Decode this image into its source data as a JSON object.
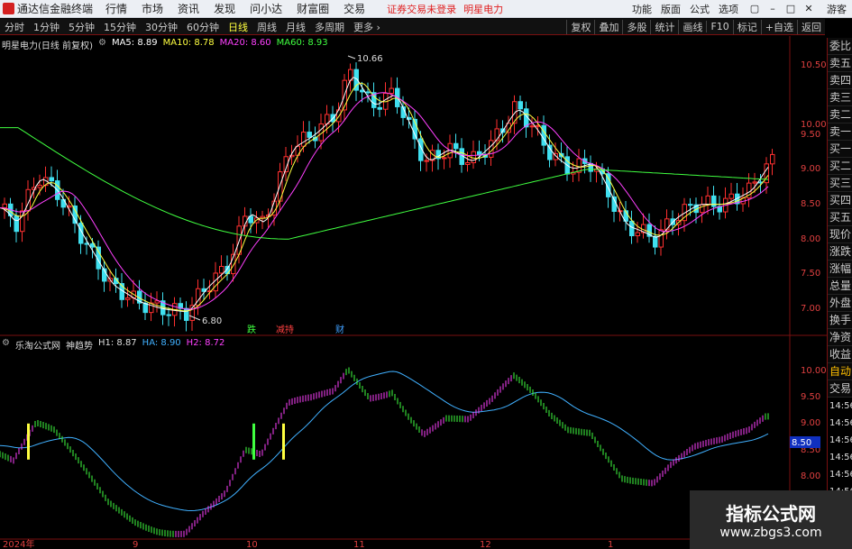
{
  "menubar": {
    "app_title": "通达信金融终端",
    "items": [
      "行情",
      "市场",
      "资讯",
      "发现",
      "问小达",
      "财富圈",
      "交易"
    ],
    "alert": "证券交易未登录",
    "stock": "明星电力",
    "tools": [
      "功能",
      "版面",
      "公式",
      "选项"
    ],
    "user": "游客"
  },
  "tabbar": {
    "tabs": [
      "分时",
      "1分钟",
      "5分钟",
      "15分钟",
      "30分钟",
      "60分钟",
      "日线",
      "周线",
      "月线",
      "多周期",
      "更多"
    ],
    "active": "日线",
    "right_buttons": [
      "复权",
      "叠加",
      "多股",
      "统计",
      "画线",
      "F10",
      "标记",
      "+自选",
      "返回"
    ]
  },
  "main_legend": {
    "title": "明星电力(日线 前复权)",
    "ma": [
      {
        "label": "MA5: 8.89",
        "color": "#ffffff"
      },
      {
        "label": "MA10: 8.78",
        "color": "#ffff40"
      },
      {
        "label": "MA20: 8.60",
        "color": "#ff40ff"
      },
      {
        "label": "MA60: 8.93",
        "color": "#40ff40"
      }
    ]
  },
  "main_axis": {
    "labels": [
      "10.50",
      "10.00",
      "9.50",
      "9.00",
      "8.50",
      "8.00",
      "7.50",
      "7.00"
    ]
  },
  "annotations": {
    "high": "10.66",
    "low": "6.80",
    "sig1": "跌",
    "sig2": "减持",
    "sig3": "财"
  },
  "sub_legend": {
    "name": "乐淘公式网",
    "indicator": "神趋势",
    "items": [
      {
        "label": "H1: 8.87",
        "color": "#dddddd"
      },
      {
        "label": "HA: 8.90",
        "color": "#40b0ff"
      },
      {
        "label": "H2: 8.72",
        "color": "#ff40ff"
      }
    ]
  },
  "sub_axis": {
    "labels": [
      "10.00",
      "9.50",
      "9.00",
      "8.50",
      "8.00"
    ],
    "current": "8.50"
  },
  "x_axis": {
    "labels": [
      "2024年",
      "9",
      "10",
      "11",
      "12",
      "1"
    ]
  },
  "side_panel": {
    "items": [
      "委比",
      "卖五",
      "卖四",
      "卖三",
      "卖二",
      "卖一",
      "买一",
      "买二",
      "买三",
      "买四",
      "买五",
      "现价",
      "涨跌",
      "涨幅",
      "总量",
      "外盘",
      "换手",
      "净资",
      "收益"
    ],
    "bottom": [
      "自动",
      "交易"
    ],
    "times": [
      "14:56",
      "14:56",
      "14:56",
      "14:56",
      "14:56",
      "14:56",
      "14:56",
      "14:56",
      "14:56"
    ]
  },
  "watermark": {
    "line1": "指标公式网",
    "line2": "www.zbgs3.com"
  }
}
